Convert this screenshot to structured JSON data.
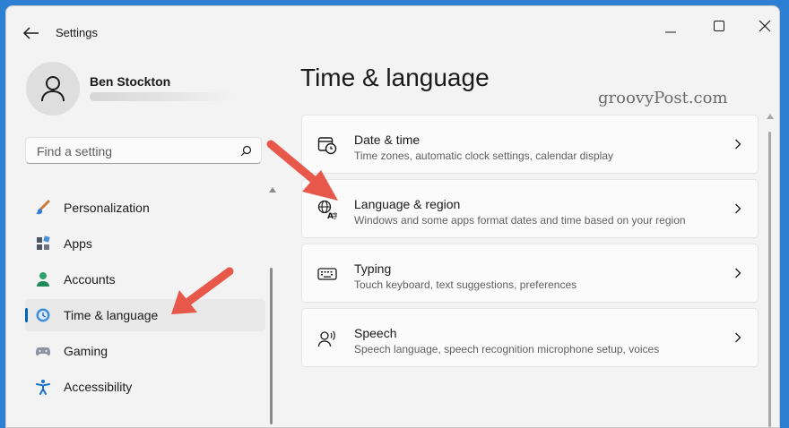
{
  "app": {
    "title": "Settings"
  },
  "user": {
    "name": "Ben Stockton"
  },
  "search": {
    "placeholder": "Find a setting"
  },
  "sidebar": {
    "items": [
      {
        "label": "Personalization",
        "icon": "paintbrush-icon"
      },
      {
        "label": "Apps",
        "icon": "apps-icon"
      },
      {
        "label": "Accounts",
        "icon": "person-icon"
      },
      {
        "label": "Time & language",
        "icon": "clock-globe-icon",
        "selected": true
      },
      {
        "label": "Gaming",
        "icon": "gamepad-icon"
      },
      {
        "label": "Accessibility",
        "icon": "accessibility-icon"
      }
    ]
  },
  "main": {
    "title": "Time & language",
    "cards": [
      {
        "title": "Date & time",
        "desc": "Time zones, automatic clock settings, calendar display",
        "icon": "calendar-clock-icon"
      },
      {
        "title": "Language & region",
        "desc": "Windows and some apps format dates and time based on your region",
        "icon": "language-icon"
      },
      {
        "title": "Typing",
        "desc": "Touch keyboard, text suggestions, preferences",
        "icon": "keyboard-icon"
      },
      {
        "title": "Speech",
        "desc": "Speech language, speech recognition microphone setup, voices",
        "icon": "speech-icon"
      }
    ]
  },
  "watermark": "groovyPost.com",
  "colors": {
    "accent": "#0067c0",
    "arrow": "#e8584a",
    "desktop": "#2d7fd3"
  }
}
